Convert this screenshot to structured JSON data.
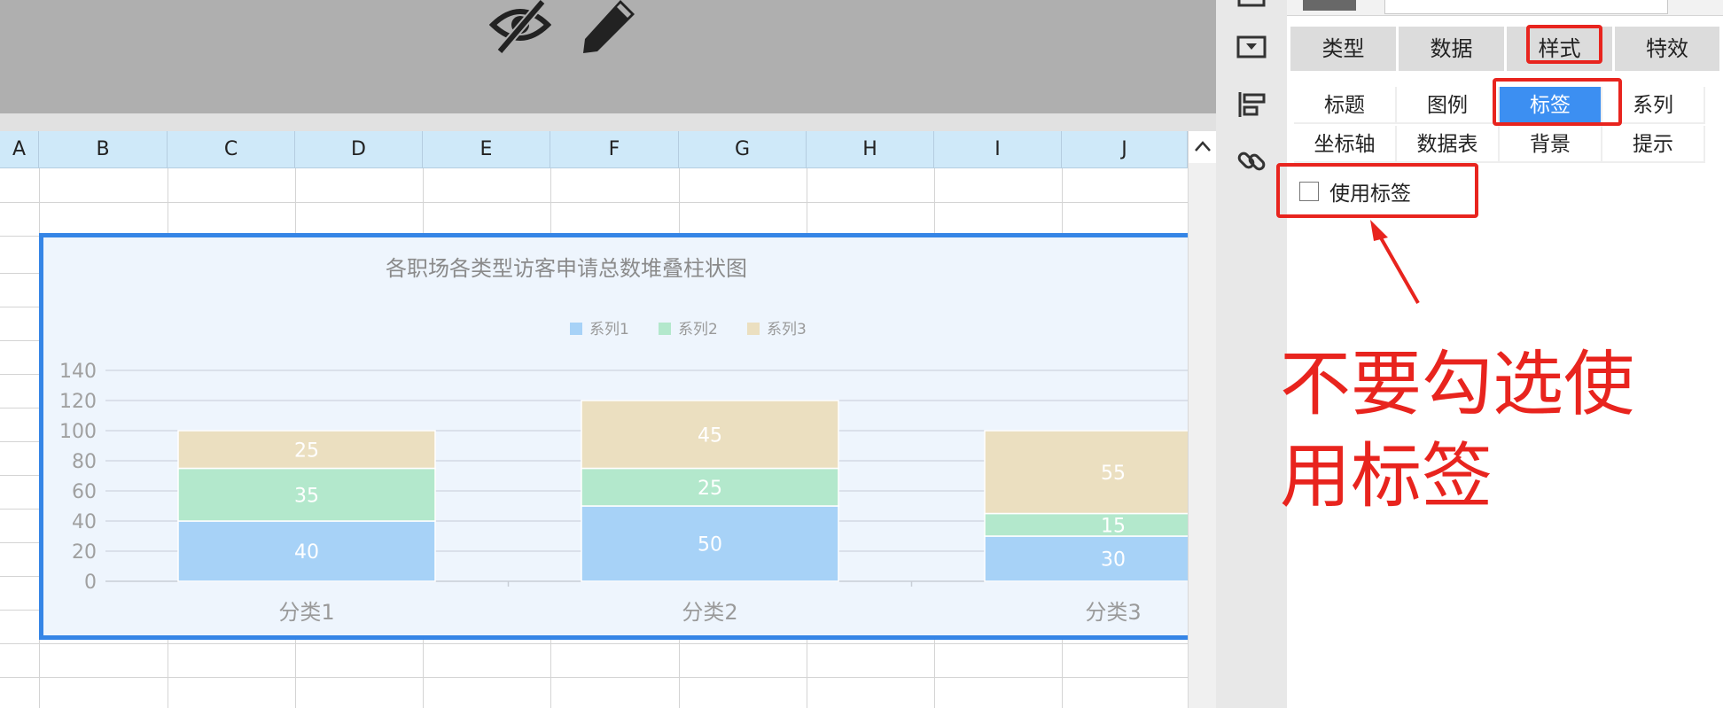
{
  "spreadsheet": {
    "column_headers": [
      "A",
      "B",
      "C",
      "D",
      "E",
      "F",
      "G",
      "H",
      "I",
      "J"
    ]
  },
  "chart_data": {
    "type": "bar",
    "stacked": true,
    "title": "各职场各类型访客申请总数堆叠柱状图",
    "categories": [
      "分类1",
      "分类2",
      "分类3"
    ],
    "series": [
      {
        "name": "系列1",
        "values": [
          40,
          50,
          30
        ],
        "color": "#a7d2f7"
      },
      {
        "name": "系列2",
        "values": [
          35,
          25,
          15
        ],
        "color": "#b3e8cc"
      },
      {
        "name": "系列3",
        "values": [
          25,
          45,
          55
        ],
        "color": "#ebdfc0"
      }
    ],
    "yticks": [
      "0",
      "20",
      "40",
      "60",
      "80",
      "100",
      "120",
      "140"
    ],
    "ylim": [
      0,
      140
    ],
    "legend_position": "top-center",
    "grid": true,
    "data_labels": true
  },
  "panel": {
    "main_tabs": [
      {
        "label": "类型"
      },
      {
        "label": "数据"
      },
      {
        "label": "样式"
      },
      {
        "label": "特效"
      }
    ],
    "sub_tabs_row1": [
      {
        "label": "标题"
      },
      {
        "label": "图例"
      },
      {
        "label": "标签",
        "active": true
      },
      {
        "label": "系列"
      }
    ],
    "sub_tabs_row2": [
      {
        "label": "坐标轴"
      },
      {
        "label": "数据表"
      },
      {
        "label": "背景"
      },
      {
        "label": "提示"
      }
    ],
    "use_label": {
      "label": "使用标签",
      "checked": false
    }
  },
  "annotation": {
    "line1": "不要勾选使",
    "line2": "用标签"
  },
  "icons": {
    "toolbar": [
      "eye-slash-icon",
      "pencil-icon"
    ],
    "rail": [
      "frame-icon",
      "layout-icon",
      "align-icon",
      "link-icon"
    ]
  },
  "colors": {
    "accent": "#3c8ff2",
    "highlight_red": "#e8241e",
    "chart_border": "#3585e6"
  }
}
